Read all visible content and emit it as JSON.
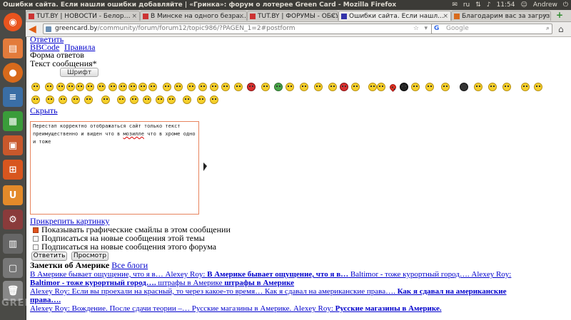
{
  "panel": {
    "window_title": "Ошибки сайта. Если нашли ошибки добавляйте | «Гринка»: форум о лотерее Green Card - Mozilla Firefox",
    "keyboard": "ru",
    "time": "11:54",
    "user": "Andrew"
  },
  "tabs": [
    {
      "label": "TUT.BY | НОВОСТИ - Белор…",
      "active": false
    },
    {
      "label": "В Минске на одного безра…",
      "active": false
    },
    {
      "label": "TUT.BY | ФОРУМЫ - ОБСУ…",
      "active": false
    },
    {
      "label": "Ошибки сайта. Если нашл…",
      "active": true
    },
    {
      "label": "Благодарим вас за загруз…",
      "active": false
    }
  ],
  "nav": {
    "url_host": "greencard.by",
    "url_path": "/community/forum/forum12/topic986/?PAGEN_1=2#postform",
    "search_placeholder": "Google",
    "search_engine_icon": "G"
  },
  "form": {
    "reply_link": "Ответить",
    "bbcode_link": "BBCode",
    "rules_link": "Правила",
    "form_title": "Форма ответов",
    "message_label": "Текст сообщения*",
    "font_select": "Шрифт",
    "hide_link": "Скрыть",
    "textarea_before": "Перестап корректно отображаться сайт только текст преимущественно и виден что в ",
    "textarea_misspelled": "мозилле",
    "textarea_after": " что в хроме одно и тоже",
    "attach_link": "Прикрепить картинку",
    "checkbox_smiles": "Показывать графические смайлы в этом сообщении",
    "checkbox_topic": "Подписаться на новые сообщения этой темы",
    "checkbox_forum": "Подписаться на новые сообщения этого форума",
    "submit_button": "Ответить",
    "preview_button": "Просмотр"
  },
  "notes": {
    "heading": "Заметки об Америке",
    "all_blogs": "Все блоги",
    "line1_a": "В Америке бывает ощущение, что я в… Alexey Roy: ",
    "line1_b": "В Америке бывает ощущение, что я в…",
    "line1_c": " Baltimor - тоже курортный город…. Alexey Roy:",
    "line2_a": "Baltimor - тоже курортный город….",
    "line2_b": " штрафы в Америке ",
    "line2_c": "штрафы в Америке",
    "line3_a": "Alexey Roy: Если вы проехали на красный, то через какое-то время… Как я сдавал на американские права…. ",
    "line3_b": "Как я сдавал на американские",
    "line4_a": "права….",
    "line5_a": "Alexey Roy: Вождение. После сдачи теории –… Русские магазины в Америке. Alexey Roy: ",
    "line5_b": "Русские магазины в Америке."
  },
  "watermark": "GREENCARD.BY"
}
